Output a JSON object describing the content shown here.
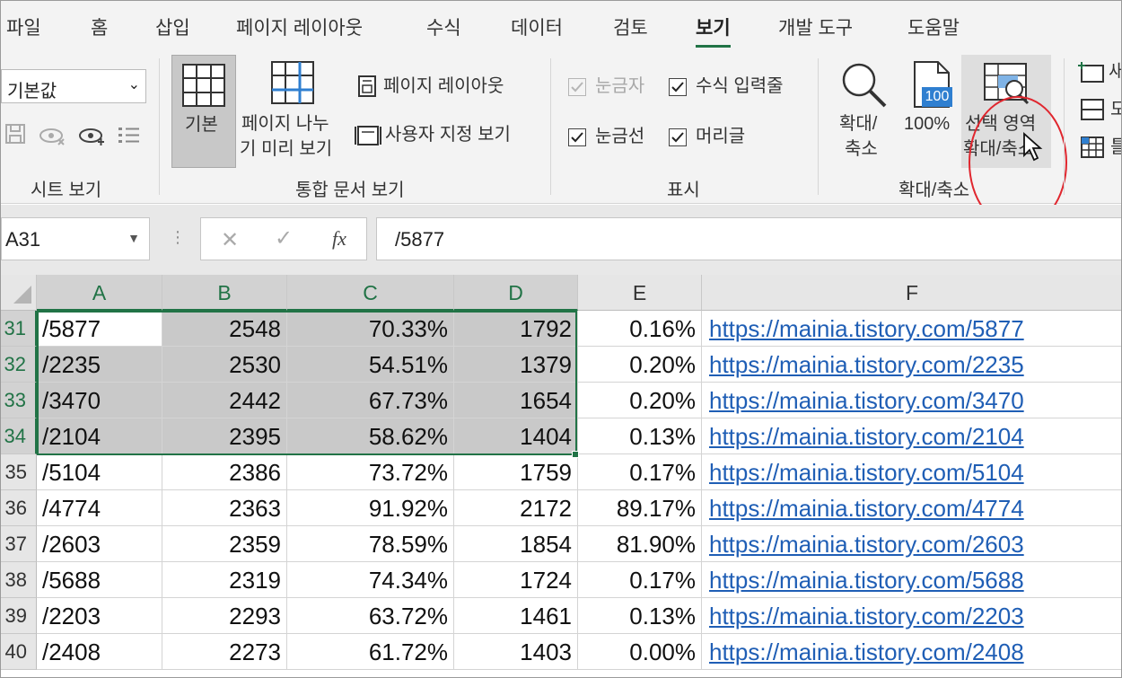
{
  "menu": {
    "tabs": [
      "파일",
      "홈",
      "삽입",
      "페이지 레이아웃",
      "수식",
      "데이터",
      "검토",
      "보기",
      "개발 도구",
      "도움말"
    ],
    "active_tab": "보기"
  },
  "ribbon": {
    "sheet_view": {
      "select_value": "기본값",
      "group_label": "시트 보기"
    },
    "workbook_views": {
      "normal_label": "기본",
      "page_break_label_1": "페이지 나누",
      "page_break_label_2": "기 미리 보기",
      "page_layout_label": "페이지 레이아웃",
      "custom_views_label": "사용자 지정 보기",
      "group_label": "통합 문서 보기"
    },
    "show": {
      "ruler_label": "눈금자",
      "formula_bar_label": "수식 입력줄",
      "gridlines_label": "눈금선",
      "headings_label": "머리글",
      "group_label": "표시"
    },
    "zoom": {
      "zoom_label_1": "확대/",
      "zoom_label_2": "축소",
      "hundred_label": "100%",
      "icon_100_text": "100",
      "zoom_sel_label_1": "선택 영역",
      "zoom_sel_label_2": "확대/축소",
      "group_label": "확대/축소"
    },
    "window": {
      "item1": "새",
      "item2": "모",
      "item3": "틀"
    }
  },
  "formula_bar": {
    "name_box": "A31",
    "fx": "fx",
    "value": "/5877"
  },
  "grid": {
    "columns": [
      "A",
      "B",
      "C",
      "D",
      "E",
      "F"
    ],
    "rows": [
      {
        "num": "31",
        "a": "/5877",
        "b": "2548",
        "c": "70.33%",
        "d": "1792",
        "e": "0.16%",
        "f": "https://mainia.tistory.com/5877"
      },
      {
        "num": "32",
        "a": "/2235",
        "b": "2530",
        "c": "54.51%",
        "d": "1379",
        "e": "0.20%",
        "f": "https://mainia.tistory.com/2235"
      },
      {
        "num": "33",
        "a": "/3470",
        "b": "2442",
        "c": "67.73%",
        "d": "1654",
        "e": "0.20%",
        "f": "https://mainia.tistory.com/3470"
      },
      {
        "num": "34",
        "a": "/2104",
        "b": "2395",
        "c": "58.62%",
        "d": "1404",
        "e": "0.13%",
        "f": "https://mainia.tistory.com/2104"
      },
      {
        "num": "35",
        "a": "/5104",
        "b": "2386",
        "c": "73.72%",
        "d": "1759",
        "e": "0.17%",
        "f": "https://mainia.tistory.com/5104"
      },
      {
        "num": "36",
        "a": "/4774",
        "b": "2363",
        "c": "91.92%",
        "d": "2172",
        "e": "89.17%",
        "f": "https://mainia.tistory.com/4774"
      },
      {
        "num": "37",
        "a": "/2603",
        "b": "2359",
        "c": "78.59%",
        "d": "1854",
        "e": "81.90%",
        "f": "https://mainia.tistory.com/2603"
      },
      {
        "num": "38",
        "a": "/5688",
        "b": "2319",
        "c": "74.34%",
        "d": "1724",
        "e": "0.17%",
        "f": "https://mainia.tistory.com/5688"
      },
      {
        "num": "39",
        "a": "/2203",
        "b": "2293",
        "c": "63.72%",
        "d": "1461",
        "e": "0.13%",
        "f": "https://mainia.tistory.com/2203"
      },
      {
        "num": "40",
        "a": "/2408",
        "b": "2273",
        "c": "61.72%",
        "d": "1403",
        "e": "0.00%",
        "f": "https://mainia.tistory.com/2408"
      }
    ]
  },
  "colors": {
    "accent": "#217346",
    "link": "#1f5eb5",
    "highlight_circle": "#e0262e",
    "selection_fill": "#c9c9c9"
  }
}
